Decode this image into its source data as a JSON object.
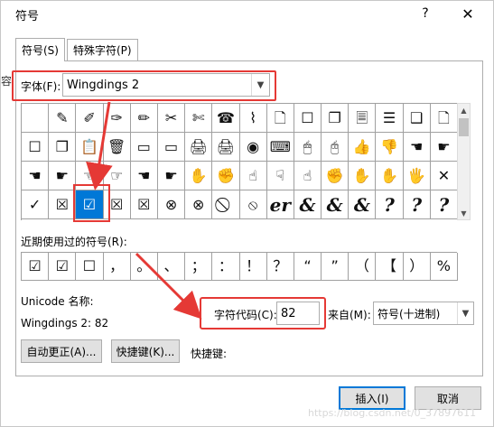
{
  "window": {
    "title": "符号",
    "help": "?",
    "close": "✕"
  },
  "side_char": "容",
  "tabs": [
    {
      "label": "符号(S)"
    },
    {
      "label": "特殊字符(P)"
    }
  ],
  "font": {
    "label": "字体(F):",
    "value": "Wingdings 2"
  },
  "grid_rows": [
    [
      "",
      "✎",
      "✐",
      "✑",
      "✏",
      "✂",
      "✄",
      "☎",
      "⌇",
      "🗋",
      "☐",
      "❐",
      "🗏",
      "☰",
      "❑",
      "🗋"
    ],
    [
      "☐",
      "❐",
      "📋",
      "🗑",
      "▭",
      "▭",
      "🖨",
      "🖨",
      "◉",
      "⌨",
      "🖱",
      "🖰",
      "👍",
      "👎",
      "☚",
      "☛"
    ],
    [
      "☚",
      "☛",
      "☜",
      "☞",
      "☚",
      "☛",
      "✋",
      "✊",
      "☝",
      "☟",
      "☝",
      "✊",
      "✋",
      "✋",
      "🖐",
      "✕"
    ],
    [
      "✓",
      "☒",
      "☑",
      "☒",
      "☒",
      "⊗",
      "⊗",
      "⃠",
      "⦸",
      "er",
      "&",
      "&",
      "&",
      "?",
      "?",
      "?"
    ]
  ],
  "recent": {
    "label": "近期使用过的符号(R):",
    "symbols": [
      "☑",
      "☑",
      "☐",
      "，",
      "。",
      "、",
      "；",
      "：",
      "！",
      "？",
      "“",
      "”",
      "（",
      "【",
      "）",
      "%"
    ]
  },
  "unicode_name_label": "Unicode 名称:",
  "code_description": "Wingdings 2: 82",
  "char_code": {
    "label": "字符代码(C):",
    "value": "82"
  },
  "from": {
    "label": "来自(M):",
    "value": "符号(十进制)"
  },
  "buttons": {
    "autocorrect": "自动更正(A)...",
    "shortcut_key": "快捷键(K)...",
    "shortcut_label": "快捷键:",
    "insert": "插入(I)",
    "cancel": "取消"
  },
  "watermark": "https://blog.csdn.net/0_37897611",
  "colors": {
    "highlight": "#e53935",
    "selection": "#0078d7"
  }
}
